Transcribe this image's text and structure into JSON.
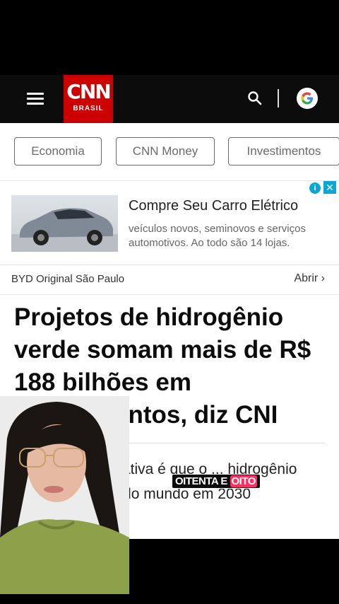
{
  "header": {
    "logo_main": "CNN",
    "logo_sub": "BRASIL"
  },
  "nav_pills": [
    "Economia",
    "CNN Money",
    "Investimentos"
  ],
  "ad": {
    "title": "Compre Seu Carro Elétrico",
    "description": "veículos novos, seminovos e serviços automotivos. Ao todo são 14 lojas.",
    "sponsor": "BYD Original São Paulo",
    "cta": "Abrir",
    "info_icon": "info-icon",
    "close_icon": "close-icon"
  },
  "article": {
    "headline": "Projetos de hidrogênio verde somam mais de R$ 188 bilhões em investimentos, diz CNI",
    "subheadline": "...gência, expectativa é que o ... hidrogênio com um dos ...s do mundo em 2030"
  },
  "caption": {
    "text": "OITENTA E ",
    "highlight": "OITO"
  },
  "colors": {
    "brand_red": "#cc0000",
    "header_bg": "#0c0c0c",
    "caption_highlight": "#ff2e63",
    "ad_accent": "#0aa6d6"
  }
}
